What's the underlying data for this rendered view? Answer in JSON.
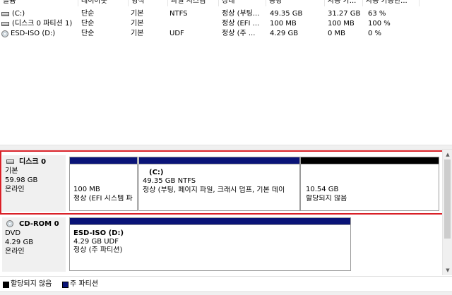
{
  "columns": [
    "볼륨",
    "레이아웃",
    "형식",
    "파일 시스템",
    "상태",
    "용량",
    "사용 가...",
    "사용 가능한..."
  ],
  "volumes": [
    {
      "name": "(C:)",
      "layout": "단순",
      "type": "기본",
      "fs": "NTFS",
      "status": "정상 (부팅...",
      "capacity": "49.35 GB",
      "free": "31.27 GB",
      "pct": "63 %",
      "icon": "drive-icon"
    },
    {
      "name": "(디스크 0 파티션 1)",
      "layout": "단순",
      "type": "기본",
      "fs": "",
      "status": "정상 (EFI ...",
      "capacity": "100 MB",
      "free": "100 MB",
      "pct": "100 %",
      "icon": "drive-icon"
    },
    {
      "name": "ESD-ISO (D:)",
      "layout": "단순",
      "type": "기본",
      "fs": "UDF",
      "status": "정상 (주 ...",
      "capacity": "4.29 GB",
      "free": "0 MB",
      "pct": "0 %",
      "icon": "disc-icon"
    }
  ],
  "disks": [
    {
      "name": "디스크 0",
      "kind": "기본",
      "size": "59.98 GB",
      "state": "온라인",
      "partitions": [
        {
          "label": "",
          "line1": "100 MB",
          "line2": "정상 (EFI 시스템 파",
          "band": "#0a1478"
        },
        {
          "label": "(C:)",
          "line1": "49.35 GB NTFS",
          "line2": "정상 (부팅, 페이지 파일, 크래시 덤프, 기본 데이",
          "band": "#0a1478"
        },
        {
          "label": "",
          "line1": "10.54 GB",
          "line2": "할당되지 않음",
          "band": "#000000"
        }
      ]
    },
    {
      "name": "CD-ROM 0",
      "kind": "DVD",
      "size": "4.29 GB",
      "state": "온라인",
      "partitions": [
        {
          "label": "ESD-ISO  (D:)",
          "line1": "4.29 GB UDF",
          "line2": "정상 (주 파티션)",
          "band": "#0a1478"
        }
      ]
    }
  ],
  "legend": [
    {
      "label": "할당되지 않음",
      "color": "#000000"
    },
    {
      "label": "주 파티션",
      "color": "#0a1478"
    }
  ],
  "colors": {
    "primary_partition": "#0a1478",
    "unallocated": "#000000",
    "selection": "#d92027"
  }
}
